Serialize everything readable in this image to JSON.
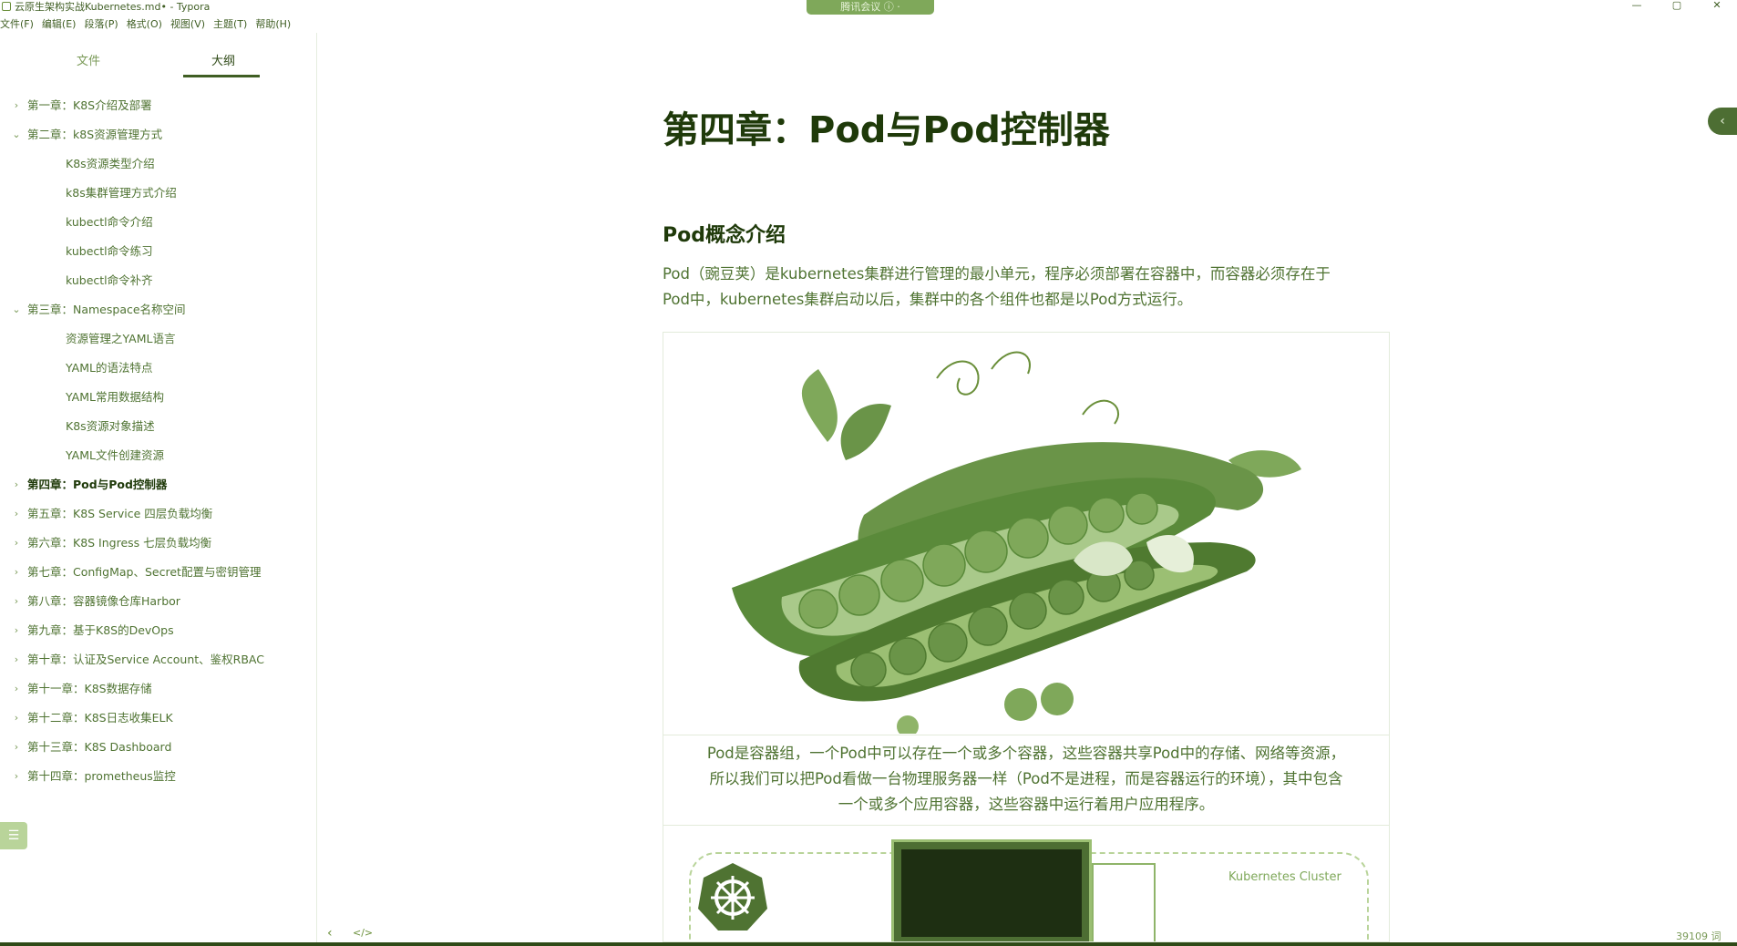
{
  "window": {
    "title": "云原生架构实战Kubernetes.md• - Typora",
    "meeting_pill": "腾讯会议 ⓘ ·",
    "minimize": "—",
    "maximize": "▢",
    "close": "✕"
  },
  "menu": [
    "文件(F)",
    "编辑(E)",
    "段落(P)",
    "格式(O)",
    "视图(V)",
    "主题(T)",
    "帮助(H)"
  ],
  "sidebar": {
    "tab_files": "文件",
    "tab_outline": "大纲",
    "outline": [
      {
        "level": 1,
        "chevron": "›",
        "text": "第一章：K8S介绍及部署"
      },
      {
        "level": 1,
        "chevron": "⌄",
        "text": "第二章：k8S资源管理方式"
      },
      {
        "level": 2,
        "text": "K8s资源类型介绍"
      },
      {
        "level": 2,
        "text": "k8s集群管理方式介绍"
      },
      {
        "level": 2,
        "text": "kubectl命令介绍"
      },
      {
        "level": 2,
        "text": "kubectl命令练习"
      },
      {
        "level": 2,
        "text": "kubectl命令补齐"
      },
      {
        "level": 1,
        "chevron": "⌄",
        "text": "第三章：Namespace名称空间"
      },
      {
        "level": 2,
        "text": "资源管理之YAML语言"
      },
      {
        "level": 2,
        "text": "YAML的语法特点"
      },
      {
        "level": 2,
        "text": "YAML常用数据结构"
      },
      {
        "level": 2,
        "text": "K8s资源对象描述"
      },
      {
        "level": 2,
        "text": "YAML文件创建资源"
      },
      {
        "level": 1,
        "chevron": "›",
        "text": "第四章：Pod与Pod控制器",
        "active": true
      },
      {
        "level": 1,
        "chevron": "›",
        "text": "第五章：K8S Service 四层负载均衡"
      },
      {
        "level": 1,
        "chevron": "›",
        "text": "第六章：K8S Ingress 七层负载均衡"
      },
      {
        "level": 1,
        "chevron": "›",
        "text": "第七章：ConfigMap、Secret配置与密钥管理"
      },
      {
        "level": 1,
        "chevron": "›",
        "text": "第八章：容器镜像仓库Harbor"
      },
      {
        "level": 1,
        "chevron": "›",
        "text": "第九章：基于K8S的DevOps"
      },
      {
        "level": 1,
        "chevron": "›",
        "text": "第十章：认证及Service Account、鉴权RBAC"
      },
      {
        "level": 1,
        "chevron": "›",
        "text": "第十一章：K8S数据存储"
      },
      {
        "level": 1,
        "chevron": "›",
        "text": "第十二章：K8S日志收集ELK"
      },
      {
        "level": 1,
        "chevron": "›",
        "text": "第十三章：K8S Dashboard"
      },
      {
        "level": 1,
        "chevron": "›",
        "text": "第十四章：prometheus监控"
      }
    ],
    "toggle_icon": "☰"
  },
  "document": {
    "h1": "第四章：Pod与Pod控制器",
    "h2": "Pod概念介绍",
    "para_line1": "Pod（豌豆荚）是kubernetes集群进行管理的最小单元，程序必须部署在容器中，而容器必须存在于",
    "para_line2": "Pod中，kubernetes集群启动以后，集群中的各个组件也都是以Pod方式运行。",
    "caption_line1": "Pod是容器组，一个Pod中可以存在一个或多个容器，这些容器共享Pod中的存储、网络等资源，",
    "caption_line2": "所以我们可以把Pod看做一台物理服务器一样（Pod不是进程，而是容器运行的环境），其中包含",
    "caption_line3": "一个或多个应用容器，这些容器中运行着用户应用程序。",
    "cluster_label": "Kubernetes Cluster"
  },
  "statusbar": {
    "back": "‹",
    "code_toggle": "</>",
    "word_count": "39109 词"
  },
  "colors": {
    "accent": "#4f7332",
    "dark": "#1f3a0a",
    "pill": "#7fa85a"
  }
}
